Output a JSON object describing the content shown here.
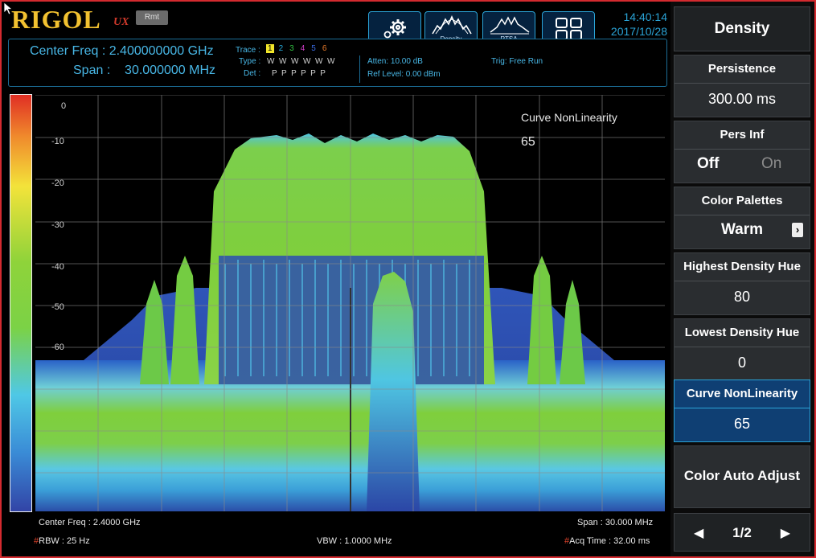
{
  "brand": {
    "logo": "RIGOL",
    "suffix": "UX",
    "rmt": "Rmt"
  },
  "toolbar": [
    {
      "name": "settings-gear",
      "label": ""
    },
    {
      "name": "density",
      "label": "Density"
    },
    {
      "name": "rtsa",
      "label": "RTSA"
    },
    {
      "name": "layout",
      "label": ""
    }
  ],
  "clock": {
    "time": "14:40:14",
    "date": "2017/10/28"
  },
  "info": {
    "center_freq": "Center Freq : 2.400000000 GHz",
    "span": "Span :    30.000000 MHz",
    "trace_label": "Trace :",
    "trace_nums": [
      "1",
      "2",
      "3",
      "4",
      "5",
      "6"
    ],
    "type_label": "Type :",
    "type_values": "W  W  W  W  W  W",
    "det_label": "Det :",
    "det_values": "P  P  P  P  P  P",
    "atten": "Atten: 10.00 dB",
    "ref_level": "Ref Level: 0.00 dBm",
    "trig": "Trig: Free Run"
  },
  "plot": {
    "y_ticks": [
      "0",
      "-10",
      "-20",
      "-30",
      "-40",
      "-50",
      "-60"
    ],
    "annotation_title": "Curve NonLinearity",
    "annotation_value": "65"
  },
  "footer": {
    "center_freq": "Center Freq : 2.4000 GHz",
    "span": "Span : 30.000 MHz",
    "rbw": "RBW : 25 Hz",
    "vbw": "VBW : 1.0000 MHz",
    "acq_time": "Acq Time : 32.00 ms"
  },
  "panel": {
    "title": "Density",
    "persistence": {
      "label": "Persistence",
      "value": "300.00 ms"
    },
    "pers_inf": {
      "label": "Pers Inf",
      "off": "Off",
      "on": "On"
    },
    "color_palettes": {
      "label": "Color Palettes",
      "value": "Warm"
    },
    "highest_hue": {
      "label": "Highest Density Hue",
      "value": "80"
    },
    "lowest_hue": {
      "label": "Lowest Density Hue",
      "value": "0"
    },
    "curve_nonlinearity": {
      "label": "Curve NonLinearity",
      "value": "65"
    },
    "color_auto_adjust": "Color Auto Adjust",
    "page": "1/2"
  },
  "colors": {
    "accent": "#2aa3d6",
    "brand": "#f2c130",
    "border": "#d42a2f"
  }
}
